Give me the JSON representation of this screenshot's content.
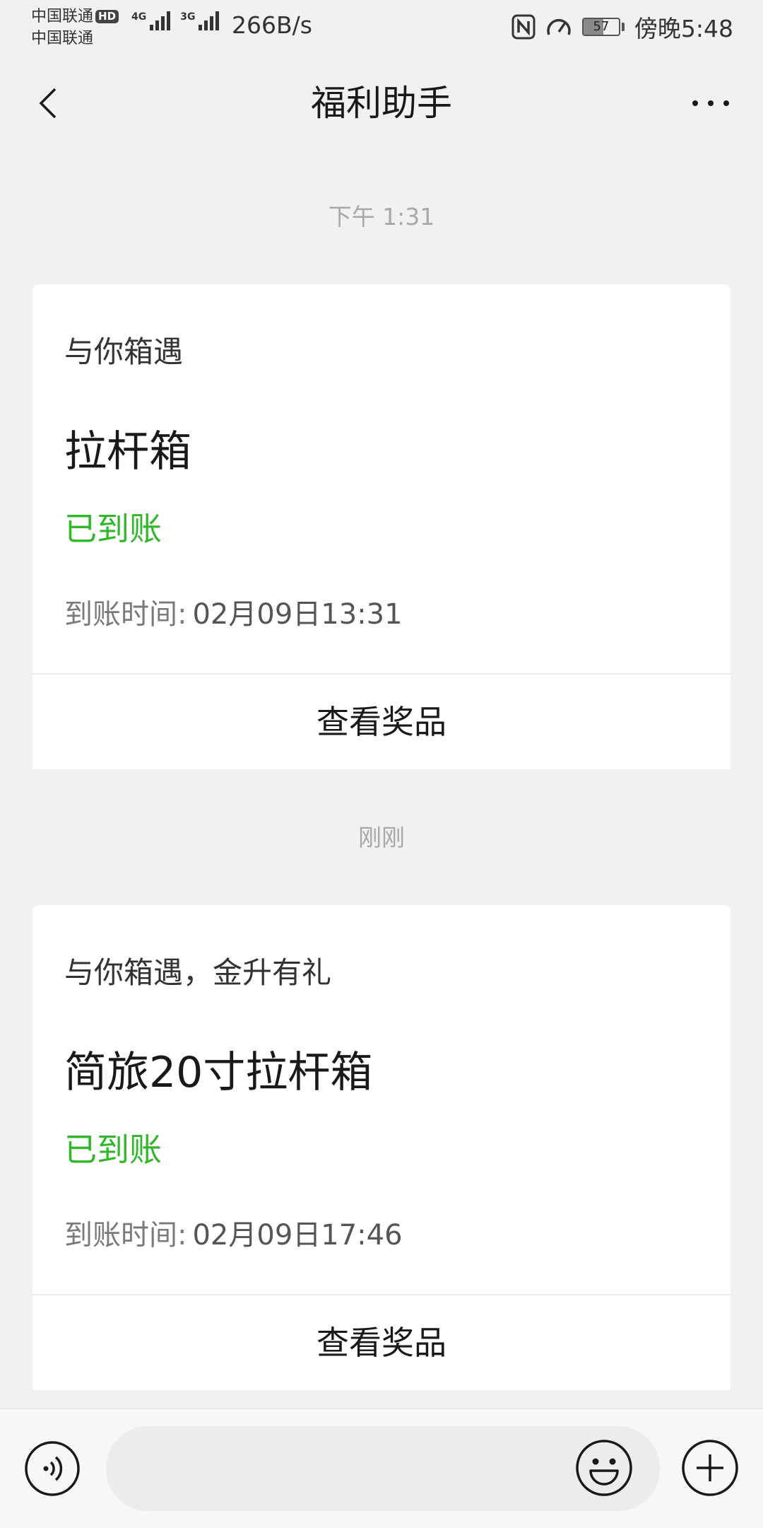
{
  "status_bar": {
    "carrier1": "中国联通",
    "hd": "HD",
    "carrier2": "中国联通",
    "signal1_label": "4G",
    "signal2_label": "3G",
    "net_speed": "266B/s",
    "battery_level": "57",
    "time": "傍晚5:48"
  },
  "header": {
    "title": "福利助手",
    "more": "···"
  },
  "messages": [
    {
      "timestamp": "下午 1:31",
      "subtitle": "与你箱遇",
      "title": "拉杆箱",
      "status": "已到账",
      "time_label": "到账时间:",
      "time_value": "02月09日13:31",
      "action": "查看奖品"
    },
    {
      "timestamp": "刚刚",
      "subtitle": "与你箱遇，金升有礼",
      "title": "简旅20寸拉杆箱",
      "status": "已到账",
      "time_label": "到账时间:",
      "time_value": "02月09日17:46",
      "action": "查看奖品"
    }
  ],
  "colors": {
    "status_green": "#31b72a",
    "background": "#f1f1f1"
  },
  "icons": {
    "back": "chevron-left-icon",
    "more": "more-dots-icon",
    "voice": "voice-icon",
    "emoji": "emoji-icon",
    "plus": "plus-icon"
  }
}
